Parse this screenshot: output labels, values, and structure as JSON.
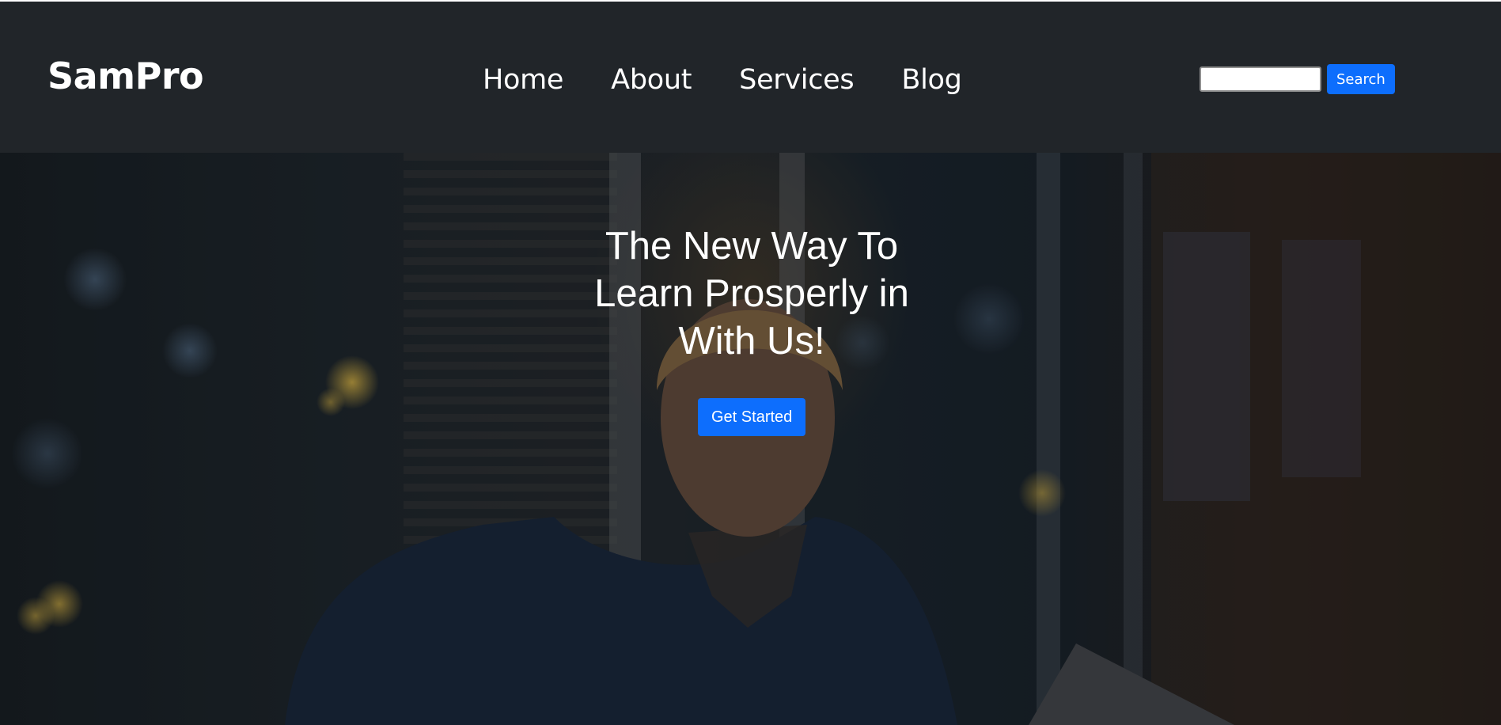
{
  "navbar": {
    "brand": "SamPro",
    "links": [
      {
        "label": "Home"
      },
      {
        "label": "About"
      },
      {
        "label": "Services"
      },
      {
        "label": "Blog"
      }
    ],
    "search": {
      "value": "",
      "placeholder": "",
      "button_label": "Search"
    }
  },
  "hero": {
    "title": "The New Way To Learn Prosperly in With Us!",
    "cta_label": "Get Started"
  },
  "colors": {
    "navbar_bg": "#212529",
    "primary": "#0d6efd",
    "text_light": "#ffffff"
  }
}
